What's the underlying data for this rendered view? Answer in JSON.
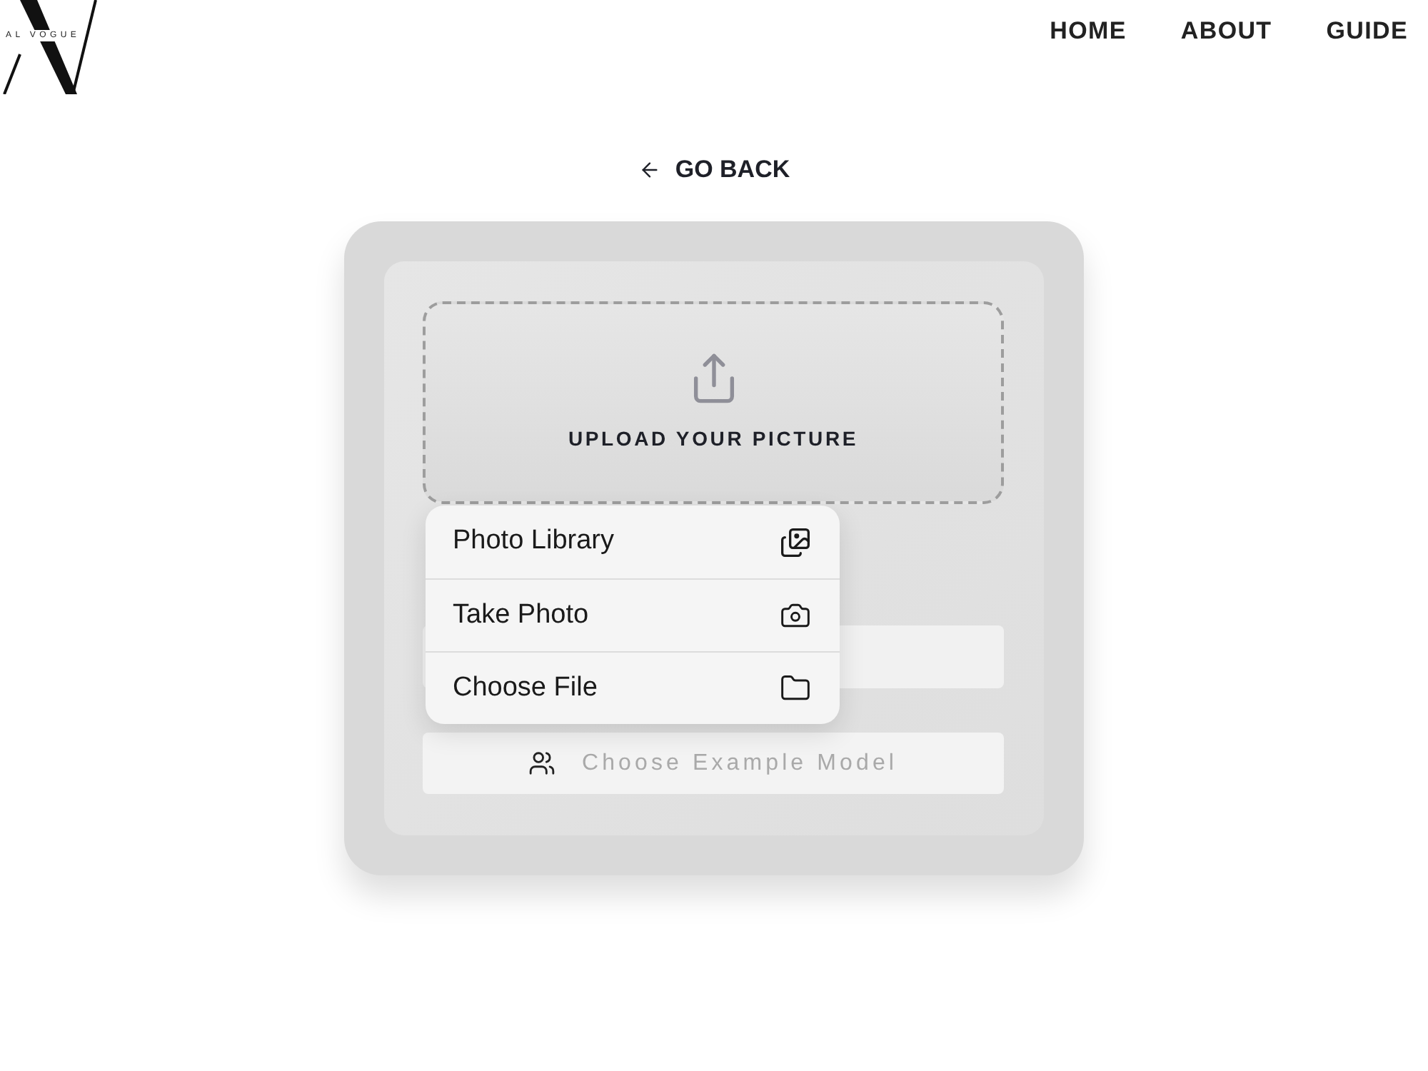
{
  "logo": {
    "text": "AL VOGUE"
  },
  "nav": [
    {
      "label": "HOME"
    },
    {
      "label": "ABOUT"
    },
    {
      "label": "GUIDE"
    }
  ],
  "back_link": {
    "label": "GO BACK"
  },
  "upload": {
    "label": "UPLOAD YOUR PICTURE"
  },
  "menu": {
    "items": [
      {
        "label": "Photo Library",
        "kind": "photos"
      },
      {
        "label": "Take Photo",
        "kind": "camera"
      },
      {
        "label": "Choose File",
        "kind": "folder"
      }
    ]
  },
  "example_button": {
    "label": "Choose Example Model"
  }
}
